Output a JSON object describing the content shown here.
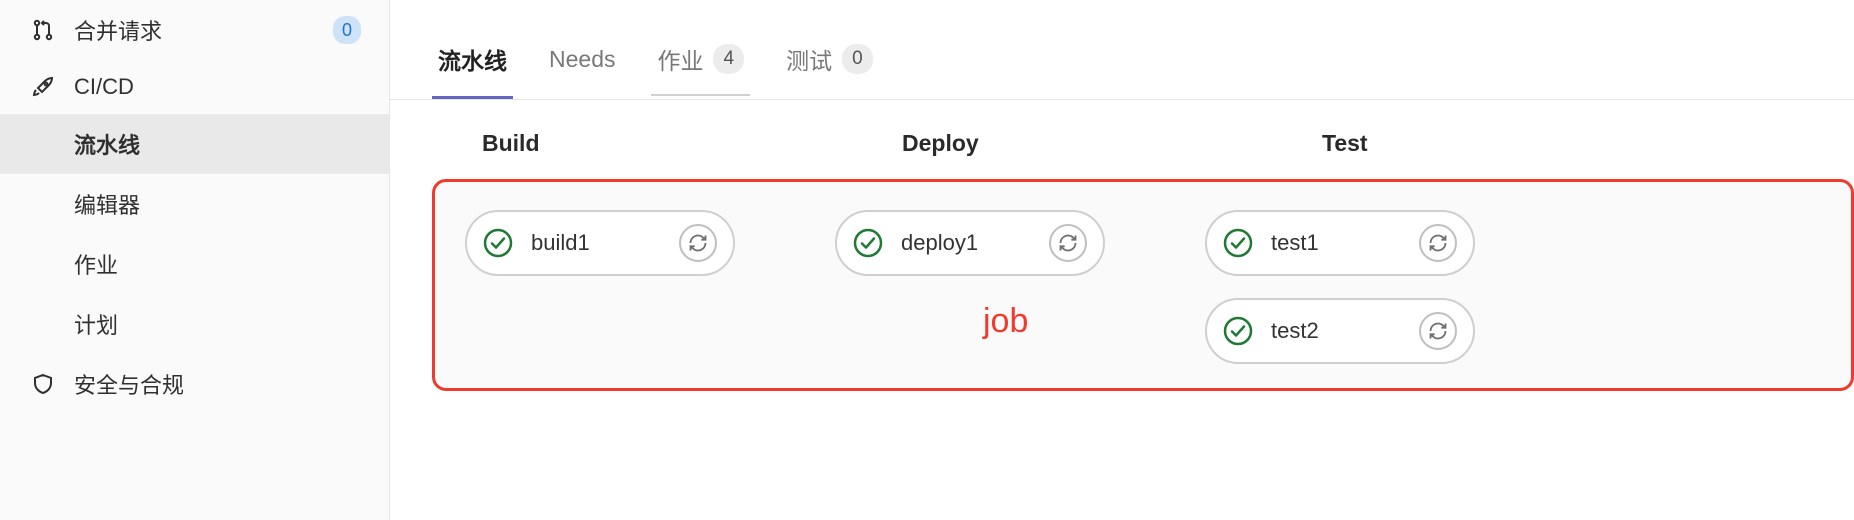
{
  "sidebar": {
    "items": [
      {
        "label": "合并请求",
        "icon": "merge-request-icon",
        "badge": "0"
      },
      {
        "label": "CI/CD",
        "icon": "rocket-icon"
      },
      {
        "label": "流水线",
        "sub": true,
        "active": true
      },
      {
        "label": "编辑器",
        "sub": true
      },
      {
        "label": "作业",
        "sub": true
      },
      {
        "label": "计划",
        "sub": true
      },
      {
        "label": "安全与合规",
        "icon": "shield-icon"
      }
    ]
  },
  "tabs": [
    {
      "label": "流水线",
      "active": true
    },
    {
      "label": "Needs"
    },
    {
      "label": "作业",
      "badge": "4",
      "underline": true
    },
    {
      "label": "测试",
      "badge": "0"
    }
  ],
  "stages": [
    {
      "header": "Build",
      "jobs": [
        {
          "name": "build1",
          "status": "passed"
        }
      ]
    },
    {
      "header": "Deploy",
      "jobs": [
        {
          "name": "deploy1",
          "status": "passed"
        }
      ]
    },
    {
      "header": "Test",
      "jobs": [
        {
          "name": "test1",
          "status": "passed"
        },
        {
          "name": "test2",
          "status": "passed"
        }
      ]
    }
  ],
  "annotation": "job"
}
